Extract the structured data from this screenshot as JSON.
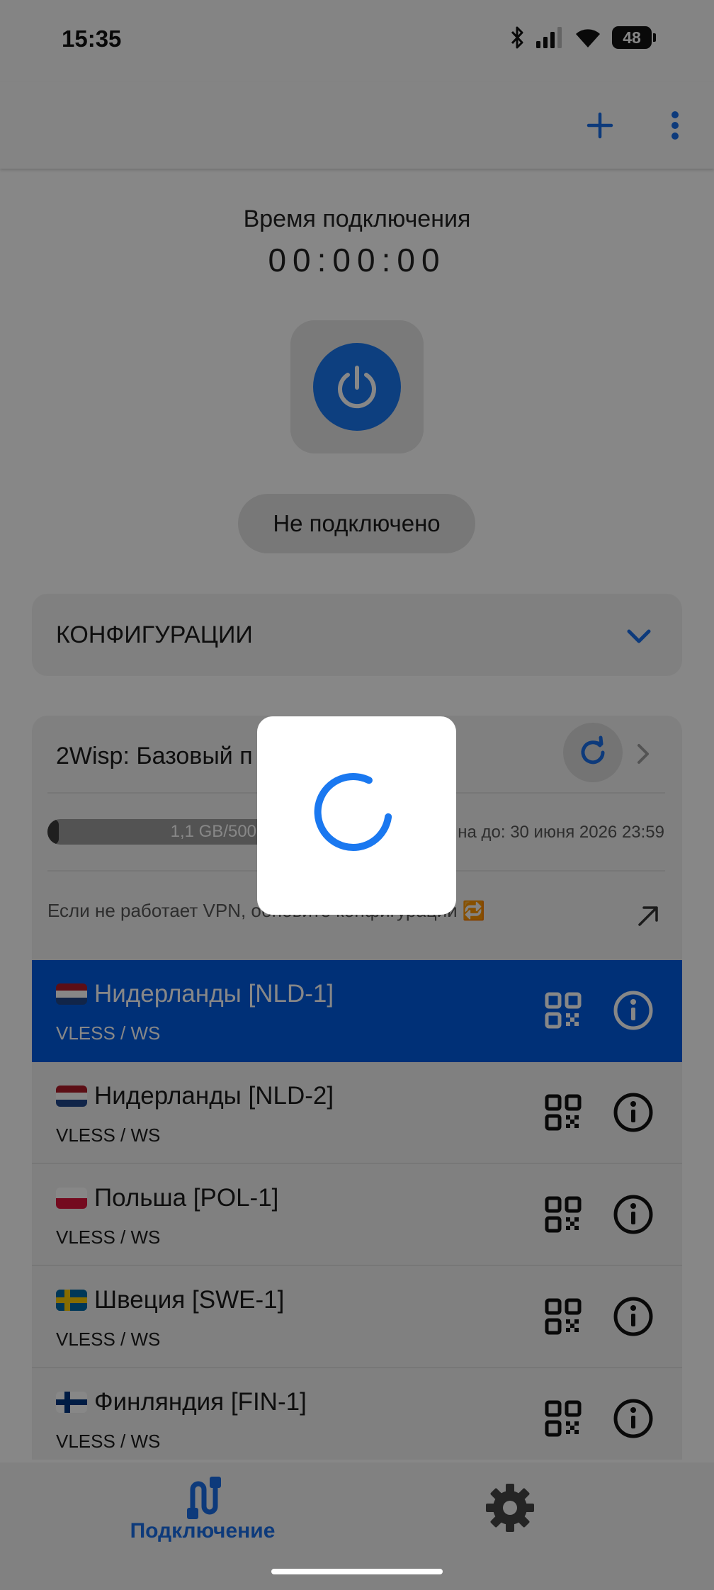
{
  "status_bar": {
    "time": "15:35",
    "battery": "48"
  },
  "app_bar": {
    "add_icon": "plus-icon",
    "more_icon": "more-vertical-icon"
  },
  "connection": {
    "time_label": "Время подключения",
    "timer": "00:00:00",
    "power_icon": "power-icon",
    "status": "Не подключено"
  },
  "configs": {
    "title": "КОНФИГУРАЦИИ"
  },
  "subscription": {
    "title": "2Wisp: Базовый п",
    "traffic": "1,1 GB/500,0 GB",
    "traffic_used_fraction": 0.0022,
    "expires": "на до: 30 июня 2026 23:59",
    "hint": "Если не работает VPN, обновите конфигурации 🔁"
  },
  "servers": [
    {
      "name": "Нидерланды [NLD-1]",
      "protocol": "VLESS / WS",
      "flag": "netherlands",
      "selected": true
    },
    {
      "name": "Нидерланды [NLD-2]",
      "protocol": "VLESS / WS",
      "flag": "netherlands",
      "selected": false
    },
    {
      "name": "Польша [POL-1]",
      "protocol": "VLESS / WS",
      "flag": "poland",
      "selected": false
    },
    {
      "name": "Швеция [SWE-1]",
      "protocol": "VLESS / WS",
      "flag": "sweden",
      "selected": false
    },
    {
      "name": "Финляндия [FIN-1]",
      "protocol": "VLESS / WS",
      "flag": "finland",
      "selected": false
    }
  ],
  "bottom_nav": {
    "connect_label": "Подключение",
    "settings_icon": "gear-icon"
  },
  "colors": {
    "accent": "#1a78f0",
    "selected_row": "#005ce0",
    "nav_active": "#1a6ee8"
  }
}
